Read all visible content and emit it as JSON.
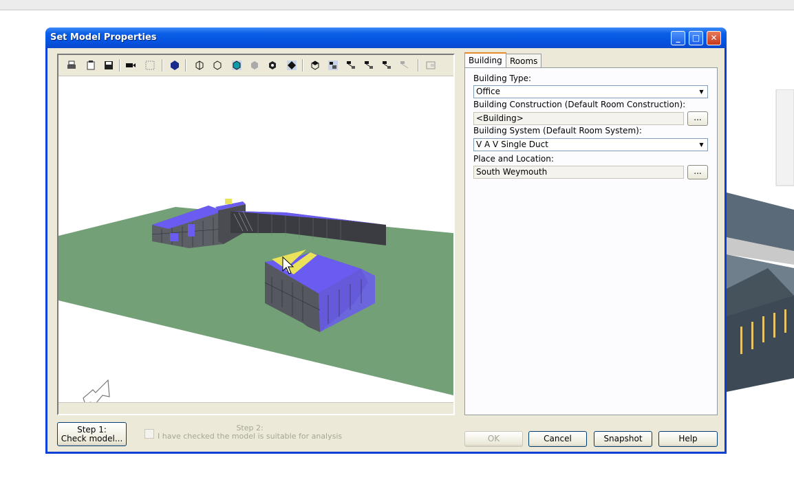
{
  "window": {
    "title": "Set Model Properties",
    "controls": {
      "minimize": "_",
      "maximize": "□",
      "close": "✕"
    }
  },
  "tabs": [
    {
      "label": "Building",
      "active": true
    },
    {
      "label": "Rooms",
      "active": false
    }
  ],
  "building": {
    "type_label": "Building Type:",
    "type_value": "Office",
    "construction_label": "Building Construction (Default Room Construction):",
    "construction_value": "<Building>",
    "system_label": "Building System (Default Room System):",
    "system_value": "V A V Single Duct",
    "location_label": "Place and Location:",
    "location_value": "South Weymouth",
    "browse_label": "..."
  },
  "step1": {
    "line1": "Step 1:",
    "line2": "Check model..."
  },
  "step2": {
    "line1": "Step 2:",
    "line2": "I have checked the model is suitable for analysis"
  },
  "buttons": {
    "ok": "OK",
    "cancel": "Cancel",
    "snapshot": "Snapshot",
    "help": "Help"
  },
  "colors": {
    "titlebar": "#0a5ee6",
    "ground": "#74a078",
    "roof": "#6a5cf0",
    "window_face": "#ece9d8"
  },
  "icons": [
    "print-icon",
    "copy-icon",
    "save-icon",
    "camera-icon",
    "grid-icon",
    "solid-icon",
    "pan-icon",
    "orbit-icon",
    "shaded-icon",
    "hidden-icon",
    "explode-icon",
    "fit-icon",
    "view-icon",
    "layers-icon",
    "tree1-icon",
    "tree2-icon",
    "tree3-icon",
    "tree4-icon",
    "tree5-icon",
    "panel-icon"
  ]
}
